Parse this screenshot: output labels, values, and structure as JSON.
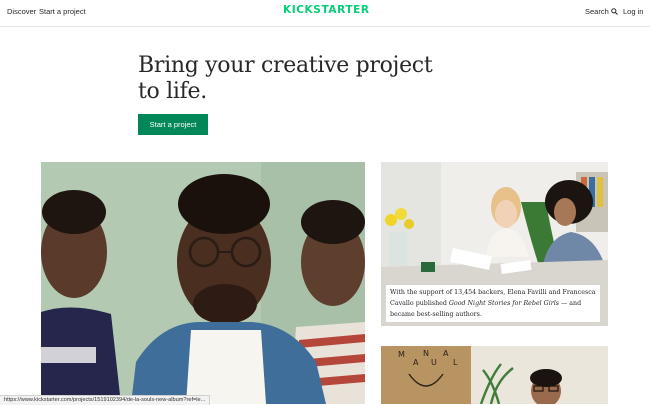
{
  "nav": {
    "discover": "Discover",
    "start_project": "Start a project",
    "logo": "KICKSTARTER",
    "search": "Search",
    "login": "Log in"
  },
  "hero": {
    "title_line1": "Bring your creative project",
    "title_line2": "to life.",
    "cta": "Start a project"
  },
  "features": {
    "caption": {
      "before": "With the support of 13,454 backers, Elena Favilli and Francesca Cavallo published ",
      "title": "Good Night Stories for Rebel Girls",
      "after": " — and became best-selling authors."
    },
    "bottom_letters": [
      "M",
      "A",
      "N",
      "U",
      "A",
      "L"
    ]
  },
  "status_bar": {
    "url": "https://www.kickstarter.com/projects/1519102394/de-la-souls-new-album?ref=le..."
  },
  "colors": {
    "brand": "#05ce78",
    "button": "#028858"
  },
  "icons": {
    "search": "search-icon"
  }
}
